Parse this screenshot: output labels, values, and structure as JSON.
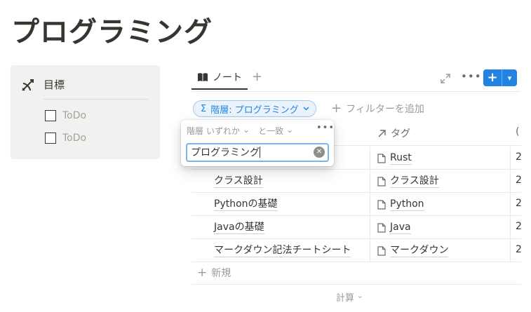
{
  "page": {
    "title": "プログラミング"
  },
  "goal": {
    "icon": "bow-and-arrow-icon",
    "title": "目標",
    "todos": [
      {
        "label": "ToDo",
        "checked": false
      },
      {
        "label": "ToDo",
        "checked": false
      }
    ]
  },
  "toolbar": {
    "view_icon": "book-icon",
    "view_label": "ノート",
    "add_view": "+",
    "new_button_accent": "#2383e2"
  },
  "filter": {
    "chip_label": "階層: プログラミング",
    "chip_icon": "sigma-icon",
    "add_filter_label": "フィルターを追加"
  },
  "popover": {
    "property": "階層",
    "aggregate": "いずれか",
    "operator": "と一致",
    "input_value": "プログラミング"
  },
  "table": {
    "columns": [
      {
        "label": "",
        "icon": ""
      },
      {
        "label": "タグ",
        "icon": "arrow-up-right-icon"
      },
      {
        "label": "(",
        "icon": "clock-icon"
      }
    ],
    "rows": [
      {
        "name": "",
        "tag": "Rust",
        "third": "2"
      },
      {
        "name": "クラス設計",
        "tag": "クラス設計",
        "third": "2"
      },
      {
        "name": "Pythonの基礎",
        "tag": "Python",
        "third": "2"
      },
      {
        "name": "Javaの基礎",
        "tag": "Java",
        "third": "2"
      },
      {
        "name": "マークダウン記法チートシート",
        "tag": "マークダウン",
        "third": "2"
      }
    ],
    "new_row_label": "新規",
    "calc_label": "計算"
  }
}
